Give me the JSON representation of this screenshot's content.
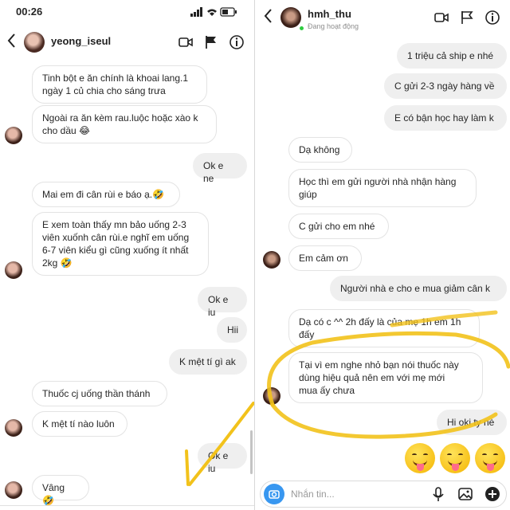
{
  "left": {
    "status": {
      "time": "00:26"
    },
    "header": {
      "username": "yeong_iseul"
    },
    "messages": [
      "Tinh bột e ăn chính là khoai lang.1\nngày 1 củ chia cho sáng trưa",
      "Ngoài ra ăn kèm rau.luộc hoặc xào k\ncho dầu 😂",
      "Ok e ne",
      "Mai em đi cân rùi e báo ạ.🤣",
      "E xem toàn thấy mn bảo uống 2-3\nviên xuốnh cân rùi.e nghĩ em uống\n6-7 viên kiểu gì cũng xuống ít nhất\n2kg 🤣",
      "Ok e iu",
      "Hii",
      "K mệt tí gì ak",
      "Thuốc cj uống thần thánh",
      "K mệt tí nào luôn",
      "Ok e iu",
      "Vâng 🤣"
    ]
  },
  "right": {
    "header": {
      "username": "hmh_thu",
      "status": "Đang hoạt động"
    },
    "messages": [
      "1 triệu cả ship e nhé",
      "C gửi 2-3 ngày hàng về",
      "E có bận học hay làm k",
      "Dạ không",
      "Học thì em gửi người nhà nhận hàng\ngiúp",
      "C gửi cho em nhé",
      "Em cảm ơn",
      "Người nhà e cho e mua giảm cân k",
      "Dạ có c ^^ 2h đấy là của mẹ 1h em 1h\nđấy",
      "Tại vì em nghe nhỏ bạn nói thuốc này\ndùng hiệu quả nên em với mẹ mới\nmua ấy chưa",
      "Hi oki ty nè"
    ],
    "input": {
      "placeholder": "Nhắn tin..."
    }
  },
  "colors": {
    "accent": "#3897f0",
    "highlight": "#f2c21b",
    "online": "#2ecc40"
  },
  "icons": [
    "back-chevron-icon",
    "video-call-icon",
    "flag-icon",
    "info-icon",
    "camera-icon",
    "microphone-icon",
    "gallery-icon",
    "add-icon"
  ]
}
